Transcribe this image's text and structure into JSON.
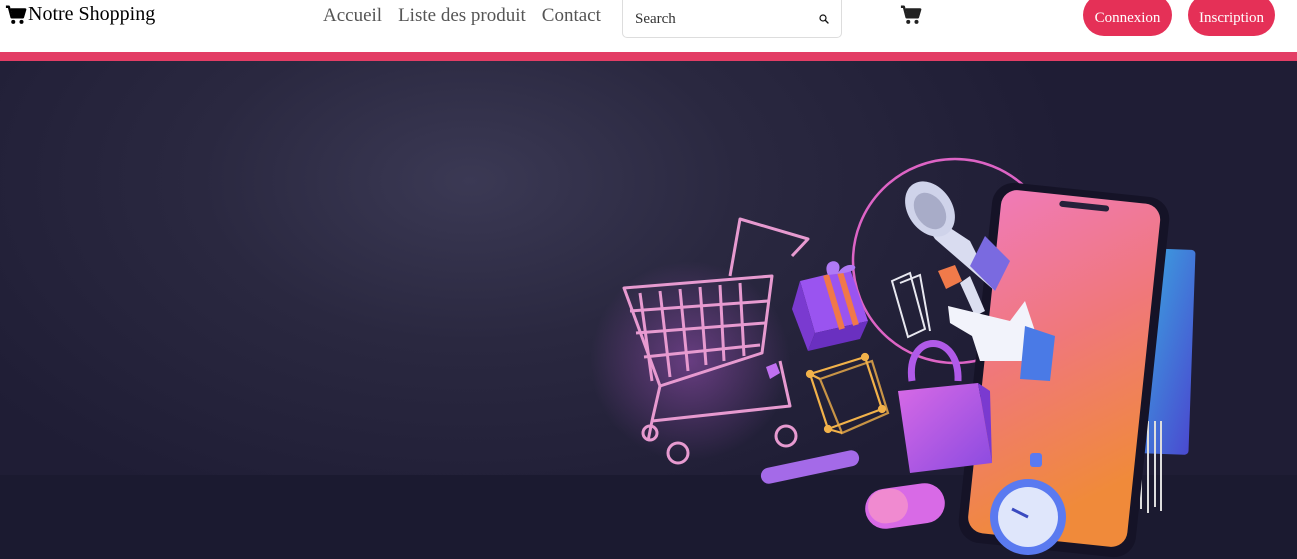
{
  "nav": {
    "brand": "Notre Shopping",
    "links": [
      {
        "label": "Accueil"
      },
      {
        "label": "Liste des produit"
      },
      {
        "label": "Contact"
      }
    ],
    "search_placeholder": "Search",
    "login_label": "Connexion",
    "register_label": "Inscription",
    "icons": [
      "cart-icon",
      "search-icon",
      "cart-icon"
    ]
  },
  "colors": {
    "accent": "#e53057",
    "bar": "#e33d65",
    "hero_bg": "#262440"
  }
}
